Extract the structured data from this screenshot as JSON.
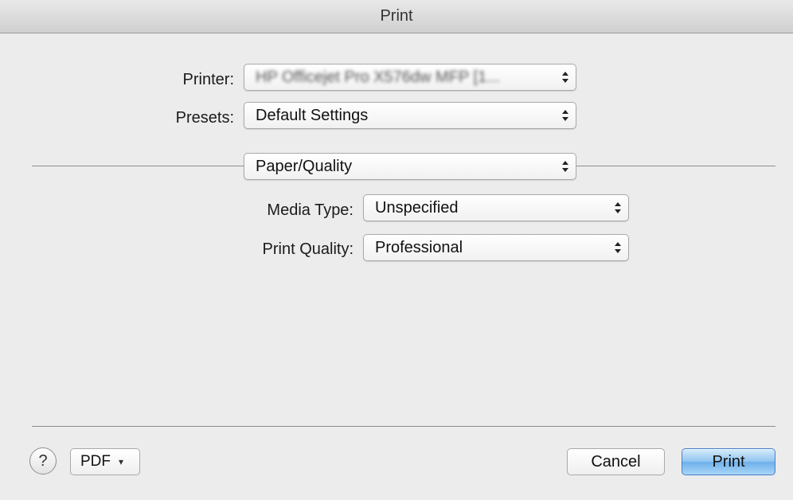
{
  "window": {
    "title": "Print"
  },
  "printer": {
    "label": "Printer:",
    "value": "HP Officejet Pro X576dw MFP [1...",
    "blurred": true
  },
  "presets": {
    "label": "Presets:",
    "value": "Default Settings"
  },
  "section": {
    "value": "Paper/Quality"
  },
  "media_type": {
    "label": "Media Type:",
    "value": "Unspecified"
  },
  "print_quality": {
    "label": "Print Quality:",
    "value": "Professional"
  },
  "footer": {
    "help_label": "?",
    "pdf_label": "PDF",
    "pdf_caret": "▾",
    "cancel_label": "Cancel",
    "print_label": "Print"
  },
  "icons": {
    "popup_arrows": "up-down-arrows-icon",
    "help": "question-mark-icon",
    "pdf_menu": "chevron-down-icon"
  },
  "colors": {
    "background": "#ececec",
    "default_button": "#8fc3ef",
    "separator": "#8e8e8e"
  }
}
